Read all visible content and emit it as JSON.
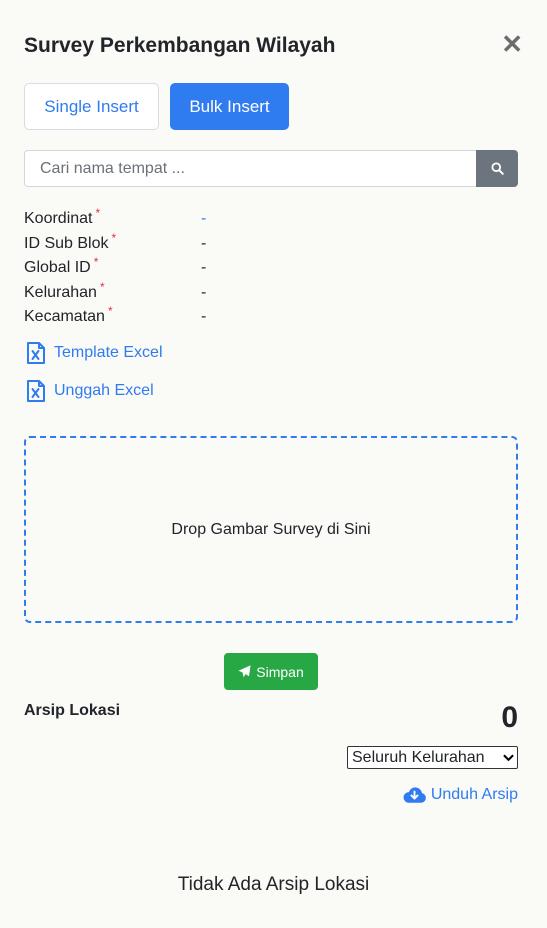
{
  "header": {
    "title": "Survey Perkembangan Wilayah",
    "close_glyph": "✕"
  },
  "tabs": [
    {
      "label": "Single Insert",
      "active": false
    },
    {
      "label": "Bulk Insert",
      "active": true
    }
  ],
  "search": {
    "placeholder": "Cari nama tempat ...",
    "value": "",
    "icon": "search-icon"
  },
  "fields": [
    {
      "label": "Koordinat",
      "required": "*",
      "value": "-"
    },
    {
      "label": "ID Sub Blok",
      "required": "*",
      "value": "-"
    },
    {
      "label": "Global ID",
      "required": "*",
      "value": "-"
    },
    {
      "label": "Kelurahan",
      "required": "*",
      "value": "-"
    },
    {
      "label": "Kecamatan",
      "required": "*",
      "value": "-"
    }
  ],
  "links": {
    "template": {
      "label": "Template Excel",
      "icon": "file-excel-icon"
    },
    "upload": {
      "label": "Unggah Excel",
      "icon": "file-excel-icon"
    }
  },
  "dropzone": {
    "label": "Drop Gambar Survey di Sini"
  },
  "save": {
    "label": "Simpan",
    "icon": "paper-plane-icon"
  },
  "archive": {
    "title": "Arsip Lokasi",
    "count": "0",
    "filter_selected": "Seluruh Kelurahan",
    "download_label": "Unduh Arsip",
    "download_icon": "cloud-download-icon",
    "empty_text": "Tidak Ada Arsip Lokasi"
  },
  "colors": {
    "primary": "#2f7bf0",
    "success": "#28a745",
    "secondary": "#6c757d",
    "required": "#dc3545",
    "background": "#fafaf7"
  }
}
